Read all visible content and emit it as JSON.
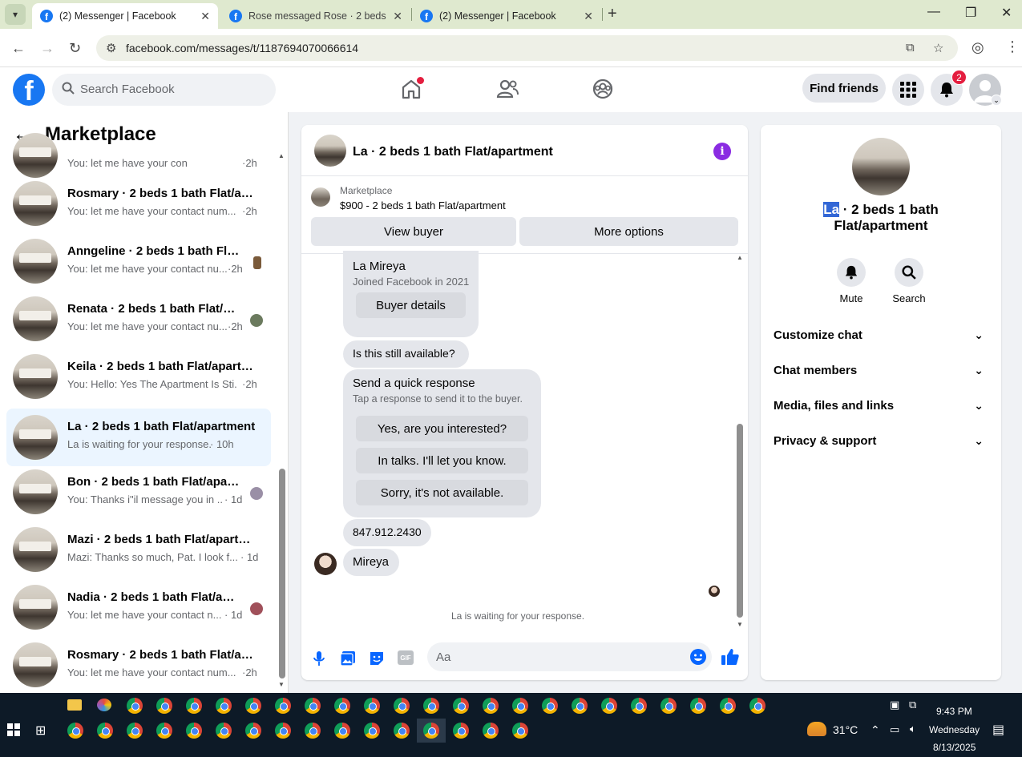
{
  "browser": {
    "tabs": [
      {
        "title": "(2) Messenger | Facebook",
        "active": true
      },
      {
        "title": "Rose messaged Rose · 2 beds 1",
        "active": false
      },
      {
        "title": "(2) Messenger | Facebook",
        "active": false
      }
    ],
    "url": "facebook.com/messages/t/1187694070066614"
  },
  "fb": {
    "search_placeholder": "Search Facebook",
    "find_friends": "Find friends",
    "notif_count": "2"
  },
  "left": {
    "back_title": "Marketplace",
    "conversations": [
      {
        "name": "",
        "sub": "You: let me have your contact num...",
        "time": "·2h",
        "partial": true
      },
      {
        "name": "Rosmary · 2 beds 1 bath Flat/apa...",
        "sub": "You: let me have your contact num...",
        "time": "·2h"
      },
      {
        "name": "Anngeline · 2 beds 1 bath Flat...",
        "sub": "You: let me have your contact nu...",
        "time": "·2h"
      },
      {
        "name": "Renata · 2 beds 1 bath Flat/ap...",
        "sub": "You: let me have your contact nu...",
        "time": "·2h"
      },
      {
        "name": "Keila · 2 beds 1 bath Flat/apartm...",
        "sub": "You: Hello: Yes The Apartment Is Sti...",
        "time": "·2h"
      },
      {
        "name": "La · 2 beds 1 bath Flat/apartment",
        "sub": "La is waiting for your response.",
        "time": "· 10h",
        "selected": true
      },
      {
        "name": "Bon · 2 beds 1 bath Flat/apart...",
        "sub": "You: Thanks i\"il message you in ...",
        "time": "· 1d"
      },
      {
        "name": "Mazi · 2 beds 1 bath Flat/apartm...",
        "sub": "Mazi: Thanks so much, Pat. I look f...",
        "time": "· 1d"
      },
      {
        "name": "Nadia · 2 beds 1 bath Flat/apa...",
        "sub": "You: let me have your contact n...",
        "time": "· 1d"
      },
      {
        "name": "Rosmary · 2 beds 1 bath Flat/apa...",
        "sub": "You: let me have your contact num...",
        "time": "·2h"
      }
    ]
  },
  "chat": {
    "title": "La · 2 beds 1 bath Flat/apartment",
    "marketplace_label": "Marketplace",
    "listing": "$900 - 2 beds 1 bath Flat/apartment",
    "view_buyer": "View buyer",
    "more_options": "More options",
    "buyer_name": "La Mireya",
    "buyer_joined": "Joined Facebook in 2021",
    "buyer_details": "Buyer details",
    "msg_available": "Is this still available?",
    "quick_title": "Send a quick response",
    "quick_sub": "Tap a response to send it to the buyer.",
    "quick_1": "Yes, are you interested?",
    "quick_2": "In talks. I'll let you know.",
    "quick_3": "Sorry, it's not available.",
    "msg_phone": "847.912.2430",
    "msg_name": "Mireya",
    "waiting": "La is waiting for your response.",
    "composer_placeholder": "Aa"
  },
  "right": {
    "name_highlight": "La",
    "name_rest_1": " · 2 beds 1 bath",
    "name_rest_2": "Flat/apartment",
    "mute": "Mute",
    "search": "Search",
    "rows": [
      "Customize chat",
      "Chat members",
      "Media, files and links",
      "Privacy & support"
    ]
  },
  "taskbar": {
    "weather": "31°C",
    "time": "9:43 PM",
    "day": "Wednesday",
    "date": "8/13/2025"
  }
}
